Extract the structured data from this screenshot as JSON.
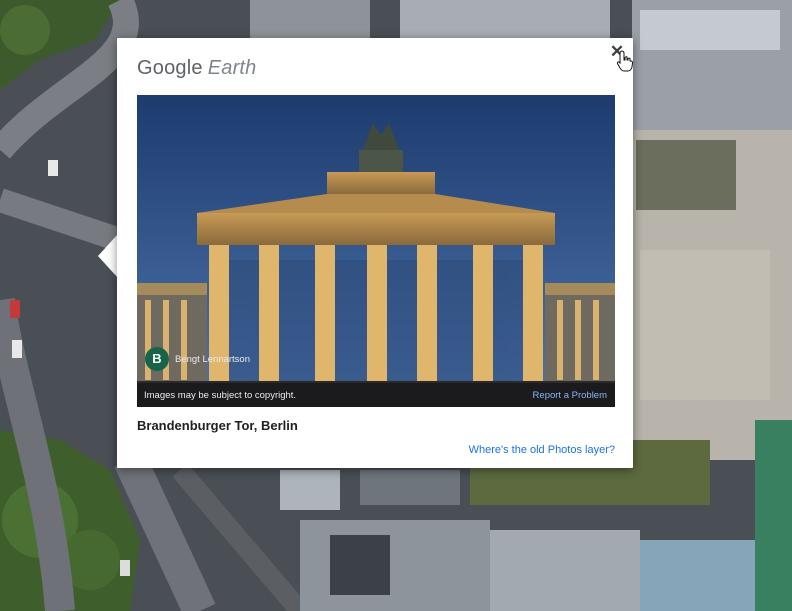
{
  "popup": {
    "brand_google": "Google",
    "brand_earth": "Earth",
    "close_symbol": "✕",
    "photo": {
      "author_initial": "B",
      "author_name": "Bengt Lennartson",
      "copyright": "Images may be subject to copyright.",
      "report_link": "Report a Problem"
    },
    "place_title": "Brandenburger Tor, Berlin",
    "old_photos_link": "Where's the old Photos layer?"
  },
  "colors": {
    "link": "#1a73e8",
    "report_link": "#8ab4f8",
    "avatar": "#17644b"
  },
  "icons": [
    "close-icon",
    "hand-cursor-icon"
  ]
}
